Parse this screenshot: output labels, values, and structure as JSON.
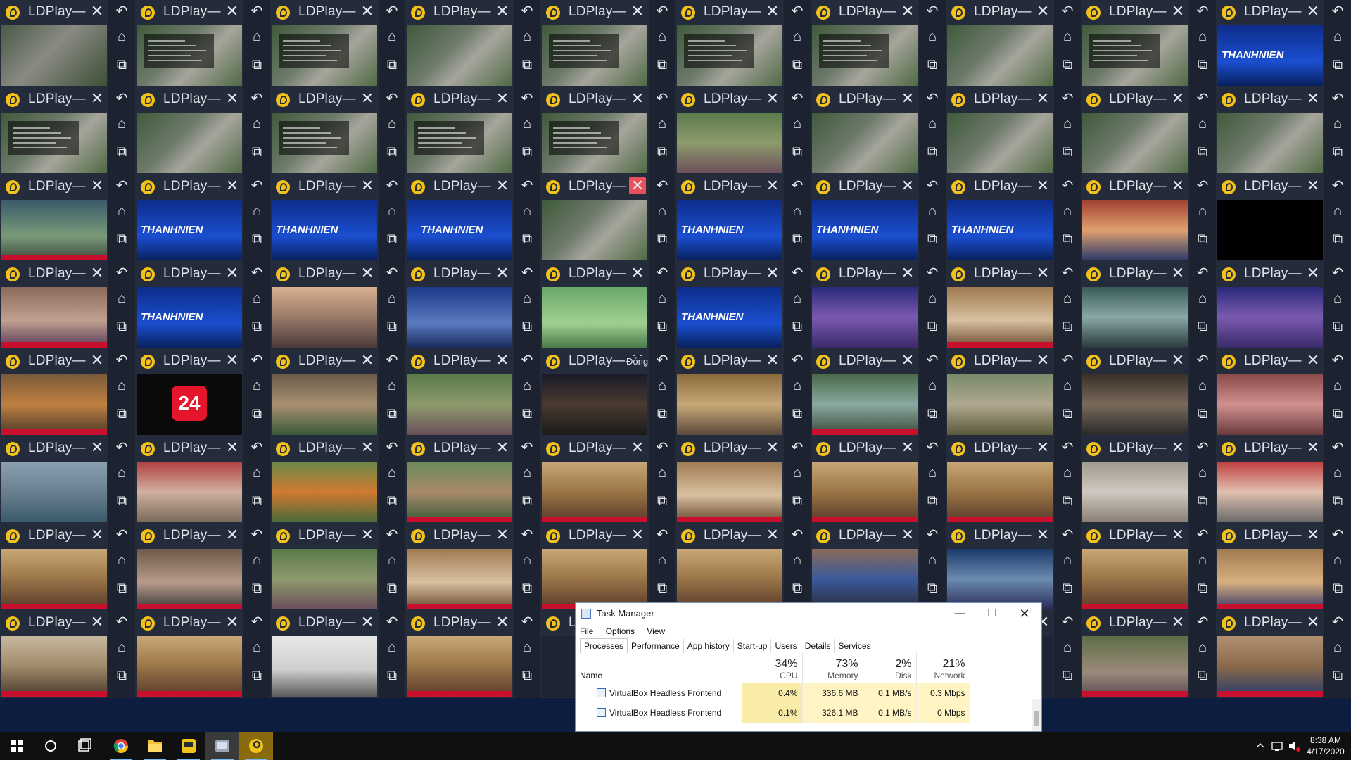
{
  "instances": {
    "title": "LDPlay—",
    "rows": 8,
    "cols": 10,
    "screens": [
      "aerial-road",
      "aerial-news",
      "aerial-news",
      "aerial",
      "aerial-news",
      "aerial-news",
      "aerial-news",
      "aerial",
      "aerial-news",
      "thanhnien",
      "aerial-news",
      "aerial",
      "aerial-news",
      "aerial-news",
      "aerial-news",
      "woman",
      "aerial",
      "aerial",
      "aerial",
      "aerial",
      "hospital",
      "thanhnien",
      "thanhnien",
      "thanhnien-plain",
      "aerial",
      "thanhnien",
      "thanhnien",
      "thanhnien",
      "studio-red",
      "black",
      "people",
      "thanhnien",
      "skyline",
      "anchor",
      "hands",
      "thanhnien",
      "anchor-woman",
      "officer",
      "medical",
      "anchor-woman",
      "crowd",
      "vtv24",
      "tea",
      "woman",
      "night-medical",
      "doorway",
      "medical-crowd",
      "village",
      "cooking",
      "market",
      "river",
      "banner-street",
      "orange-bag",
      "man-smile",
      "meeting",
      "officer",
      "meeting",
      "meeting",
      "feet",
      "quarantine",
      "meeting",
      "woman-door",
      "woman",
      "officer",
      "meeting",
      "meeting",
      "workers-mask",
      "anchor-woman2",
      "meeting",
      "officer-mask",
      "meeting-table",
      "meeting",
      "laptop",
      "meeting",
      "blank",
      "blank",
      "blank",
      "blank",
      "woman-old",
      "meeting-blue"
    ],
    "highlight_close_index": 24,
    "extra_label_tile": 44,
    "extra_label": "Đóng",
    "badge_24": "24",
    "thanhnien_text": "THANHNIEN"
  },
  "task_manager": {
    "title": "Task Manager",
    "menu": [
      "File",
      "Options",
      "View"
    ],
    "tabs": [
      "Processes",
      "Performance",
      "App history",
      "Start-up",
      "Users",
      "Details",
      "Services"
    ],
    "active_tab": "Processes",
    "columns": {
      "name": "Name",
      "cpu_pct": "34%",
      "cpu": "CPU",
      "mem_pct": "73%",
      "mem": "Memory",
      "disk_pct": "2%",
      "disk": "Disk",
      "net_pct": "21%",
      "net": "Network"
    },
    "rows": [
      {
        "name": "VirtualBox Headless Frontend",
        "cpu": "0.4%",
        "memory": "336.6 MB",
        "disk": "0.1 MB/s",
        "network": "0.3 Mbps"
      },
      {
        "name": "VirtualBox Headless Frontend",
        "cpu": "0.1%",
        "memory": "326.1 MB",
        "disk": "0.1 MB/s",
        "network": "0 Mbps"
      }
    ]
  },
  "taskbar": {
    "time": "8:38 AM",
    "date": "4/17/2020",
    "apps": [
      "start-icon",
      "search-icon",
      "task-view-icon",
      "chrome-icon",
      "file-explorer-icon",
      "ldplayer-multi-icon",
      "photos-icon",
      "ldplayer-icon"
    ]
  },
  "colors": {
    "tile_bg": "#242b3a",
    "side_bg": "#1c2230",
    "logo": "#f2c21b",
    "close_highlight": "#e8505b",
    "desktop": "#0d1d40"
  }
}
